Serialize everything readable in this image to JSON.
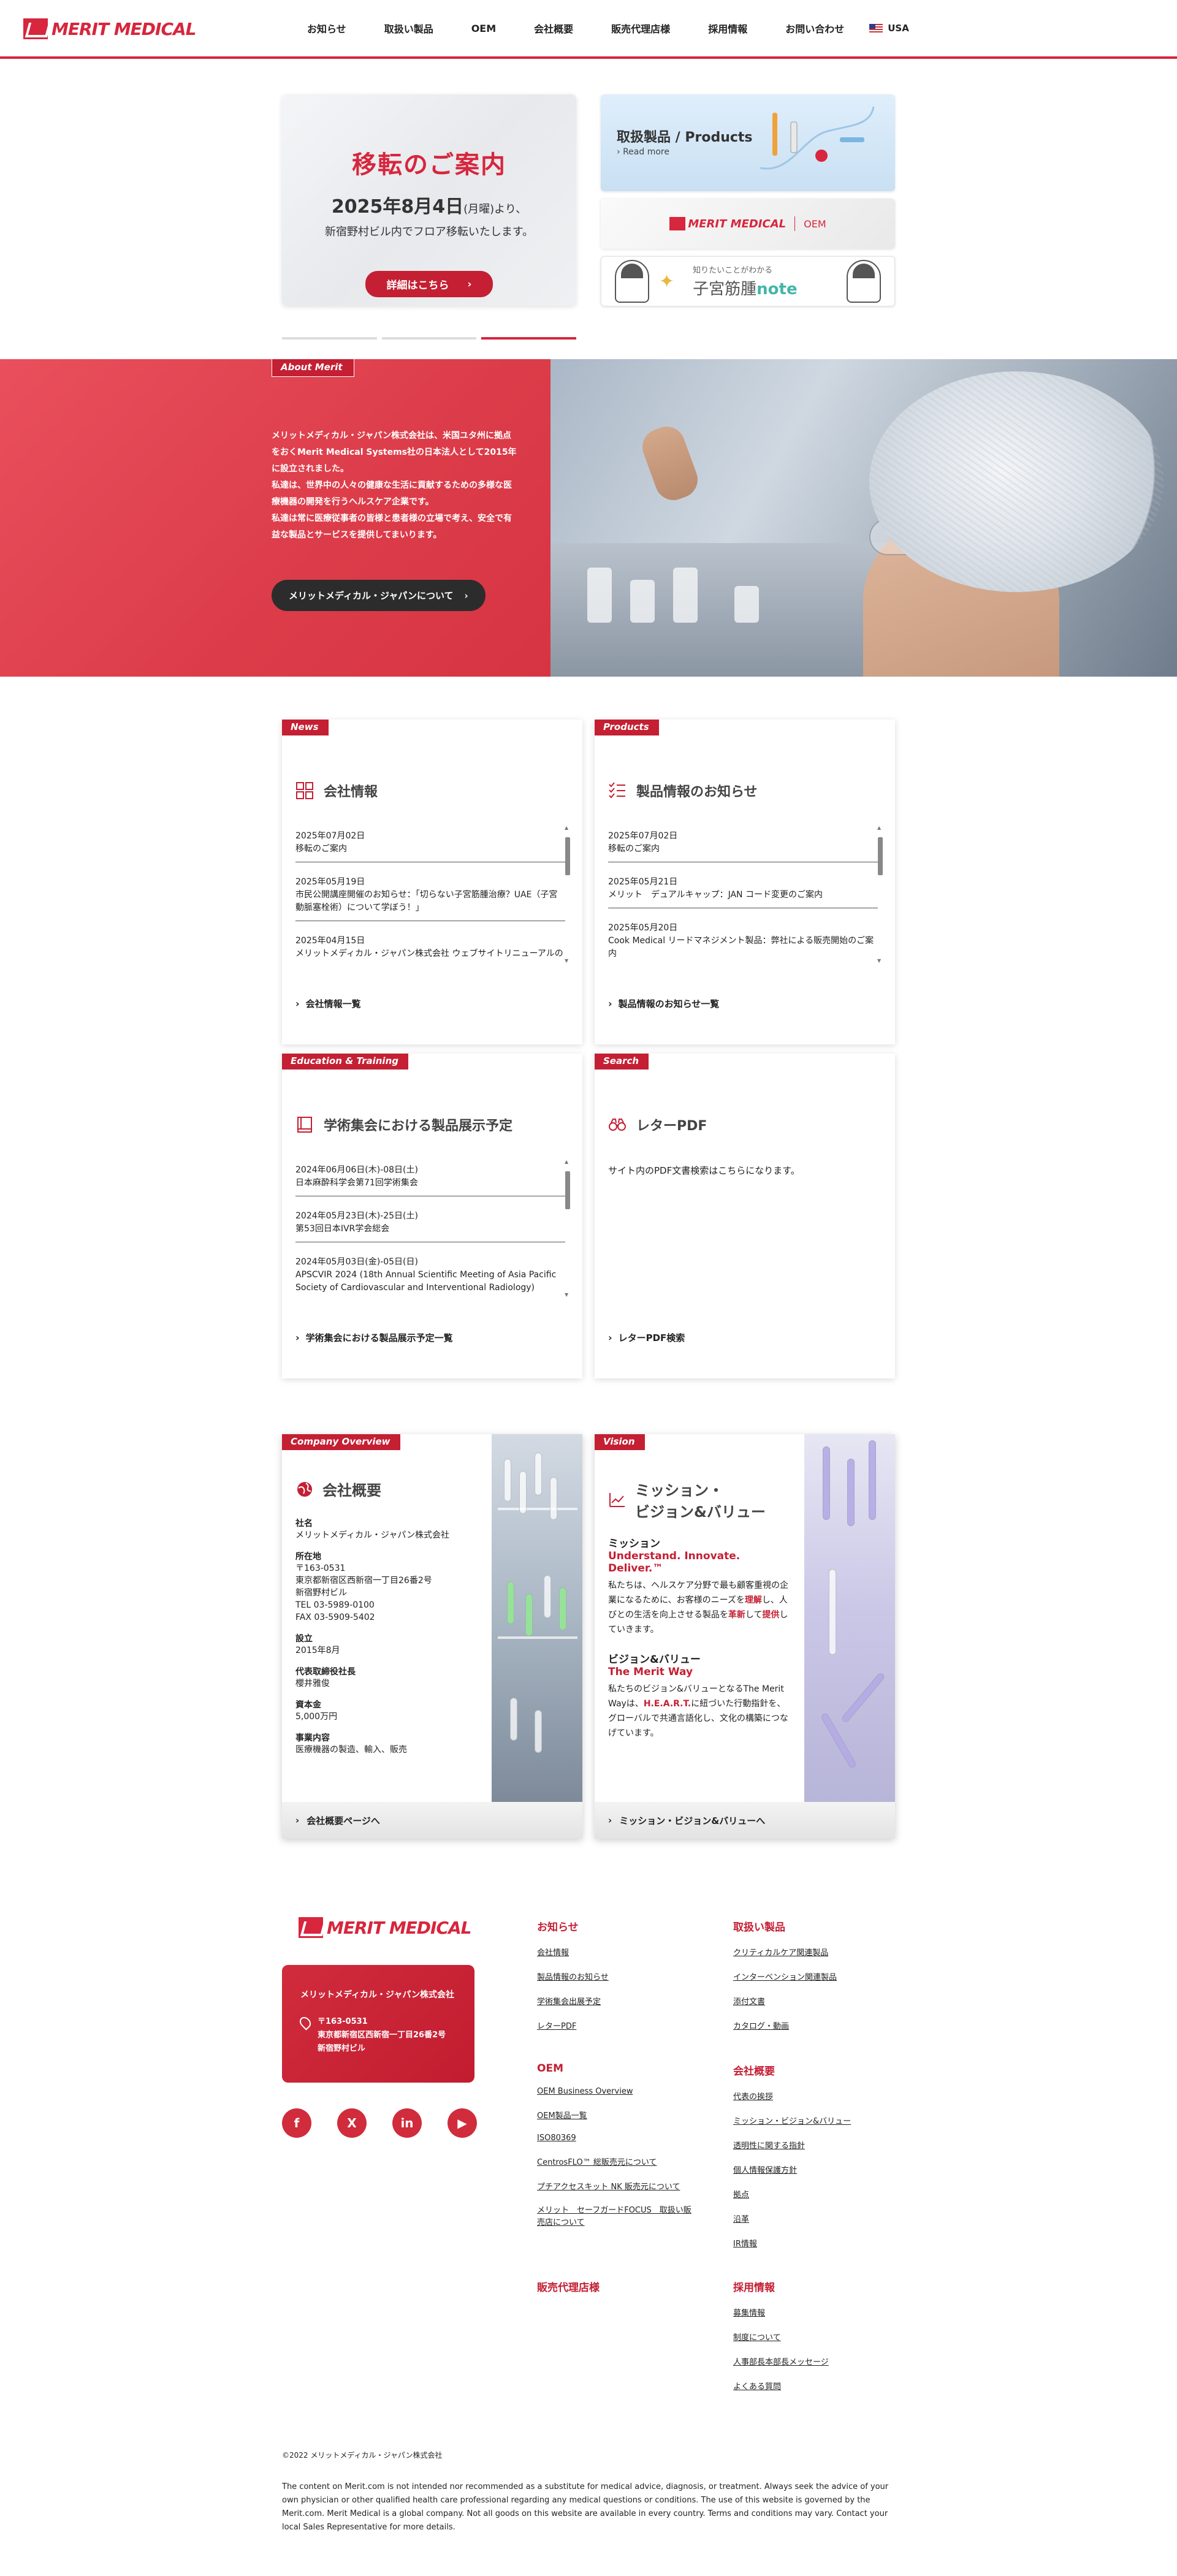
{
  "header": {
    "logo_text": "MERIT MEDICAL",
    "nav": [
      "お知らせ",
      "取扱い製品",
      "OEM",
      "会社概要",
      "販売代理店様",
      "採用情報",
      "お問い合わせ"
    ],
    "region": "USA"
  },
  "hero": {
    "slide": {
      "title": "移転のご案内",
      "date_main": "2025年8月4日",
      "date_suffix": "(月曜)より、",
      "sub": "新宿野村ビル内でフロア移転いたします。",
      "button": "詳細はこちら"
    },
    "banner_products": {
      "title": "取扱製品 / Products",
      "more": "Read more"
    },
    "banner_oem": {
      "logo": "MERIT MEDICAL",
      "label": "OEM"
    },
    "banner_note": {
      "small": "知りたいことがわかる",
      "big_prefix": "子宮筋腫",
      "big_suffix": "note"
    }
  },
  "about": {
    "tag": "About Merit",
    "text": "メリットメディカル・ジャパン株式会社は、米国ユタ州に拠点をおくMerit Medical Systems社の日本法人として2015年に設立されました。\n私達は、世界中の人々の健康な生活に貢献するための多様な医療機器の開発を行うヘルスケア企業です。\n私達は常に医療従事者の皆様と患者様の立場で考え、安全で有益な製品とサービスを提供してまいります。",
    "button": "メリットメディカル・ジャパンについて"
  },
  "news": {
    "tag": "News",
    "title": "会社情報",
    "items": [
      {
        "date": "2025年07月02日",
        "text": "移転のご案内"
      },
      {
        "date": "2025年05月19日",
        "text": "市民公開講座開催のお知らせ：「切らない子宮筋腫治療？UAE（子宮動脈塞栓術）について学ぼう！」"
      },
      {
        "date": "2025年04月15日",
        "text": "メリットメディカル・ジャパン株式会社 ウェブサイトリニューアルのお知らせ"
      }
    ],
    "link": "会社情報一覧"
  },
  "products": {
    "tag": "Products",
    "title": "製品情報のお知らせ",
    "items": [
      {
        "date": "2025年07月02日",
        "text": "移転のご案内"
      },
      {
        "date": "2025年05月21日",
        "text": "メリット　デュアルキャップ：JAN コード変更のご案内"
      },
      {
        "date": "2025年05月20日",
        "text": "Cook Medical リードマネジメント製品：弊社による販売開始のご案内"
      }
    ],
    "link": "製品情報のお知らせ一覧"
  },
  "education": {
    "tag": "Education & Training",
    "title": "学術集会における製品展示予定",
    "items": [
      {
        "date": "2024年06月06日(木)-08日(土)",
        "text": "日本麻酔科学会第71回学術集会"
      },
      {
        "date": "2024年05月23日(木)-25日(土)",
        "text": "第53回日本IVR学会総会"
      },
      {
        "date": "2024年05月03日(金)-05日(日)",
        "text": "APSCVIR 2024 (18th Annual Scientific Meeting of Asia Pacific Society of Cardiovascular and Interventional Radiology)"
      }
    ],
    "link": "学術集会における製品展示予定一覧"
  },
  "search": {
    "tag": "Search",
    "title": "レターPDF",
    "text": "サイト内のPDF文書検索はこちらになります。",
    "link": "レターPDF検索"
  },
  "company": {
    "tag": "Company Overview",
    "title": "会社概要",
    "rows": [
      {
        "label": "社名",
        "value": "メリットメディカル・ジャパン株式会社"
      },
      {
        "label": "所在地",
        "value": "〒163-0531\n東京都新宿区西新宿一丁目26番2号\n新宿野村ビル\nTEL 03-5989-0100\nFAX 03-5909-5402"
      },
      {
        "label": "設立",
        "value": "2015年8月"
      },
      {
        "label": "代表取締役社長",
        "value": "櫻井雅俊"
      },
      {
        "label": "資本金",
        "value": "5,000万円"
      },
      {
        "label": "事業内容",
        "value": "医療機器の製造、輸入、販売"
      }
    ],
    "link": "会社概要ページへ"
  },
  "vision": {
    "tag": "Vision",
    "title_line1": "ミッション・",
    "title_line2": "ビジョン&バリュー",
    "mission_head": "ミッション",
    "mission_sub": "Understand. Innovate. Deliver.™",
    "mission_p1": "私たちは、ヘルスケア分野で最も顧客重視の企業になるために、お客様のニーズを",
    "mission_b1": "理解",
    "mission_p2": "し、人びとの生活を向上させる製品を",
    "mission_b2": "革新",
    "mission_p3": "して",
    "mission_b3": "提供",
    "mission_p4": "していきます。",
    "vv_head": "ビジョン&バリュー",
    "vv_sub": "The Merit Way",
    "vv_p1": "私たちのビジョン&バリューとなるThe Merit Wayは、",
    "vv_b1": "H.E.A.R.T.",
    "vv_p2": "に紐づいた行動指針を、グローバルで共通言語化し、文化の構築につなげています。",
    "link": "ミッション・ビジョン&バリューへ"
  },
  "footer": {
    "logo_text": "MERIT MEDICAL",
    "company_name": "メリットメディカル・ジャパン株式会社",
    "address": "〒163-0531\n東京都新宿区西新宿一丁目26番2号\n新宿野村ビル",
    "socials": [
      "f",
      "X",
      "in",
      "▶"
    ],
    "col_news": {
      "title": "お知らせ",
      "links": [
        "会社情報",
        "製品情報のお知らせ",
        "学術集会出展予定",
        "レターPDF"
      ]
    },
    "col_products": {
      "title": "取扱い製品",
      "links": [
        "クリティカルケア関連製品",
        "インターベンション関連製品",
        "添付文書",
        "カタログ・動画"
      ]
    },
    "col_oem": {
      "title": "OEM",
      "links": [
        "OEM Business Overview",
        "OEM製品一覧",
        "ISO80369",
        "CentrosFLO™ 総販売元について",
        "プチアクセスキット NK 販売元について",
        "メリット　セーフガードFOCUS　取扱い販売店について"
      ]
    },
    "col_company": {
      "title": "会社概要",
      "links": [
        "代表の挨拶",
        "ミッション・ビジョン&バリュー",
        "透明性に関する指針",
        "個人情報保護方針",
        "拠点",
        "沿革",
        "IR情報"
      ]
    },
    "col_agents": {
      "title": "販売代理店様"
    },
    "col_recruit": {
      "title": "採用情報",
      "links": [
        "募集情報",
        "制度について",
        "人事部長本部長メッセージ",
        "よくある質問"
      ]
    },
    "copyright": "©2022 メリットメディカル・ジャパン株式会社",
    "disclaimer": "The content on Merit.com is not intended nor recommended as a substitute for medical advice, diagnosis, or treatment. Always seek the advice of your own physician or other qualified health care professional regarding any medical questions or conditions. The use of this website is governed by the Merit.com. Merit Medical is a global company. Not all goods on this website are available in every country. Terms and conditions may vary. Contact your local Sales Representative for more details."
  },
  "colors": {
    "brand_red": "#d7263d",
    "dark_red": "#c41f33",
    "dark": "#2c2c2c"
  }
}
